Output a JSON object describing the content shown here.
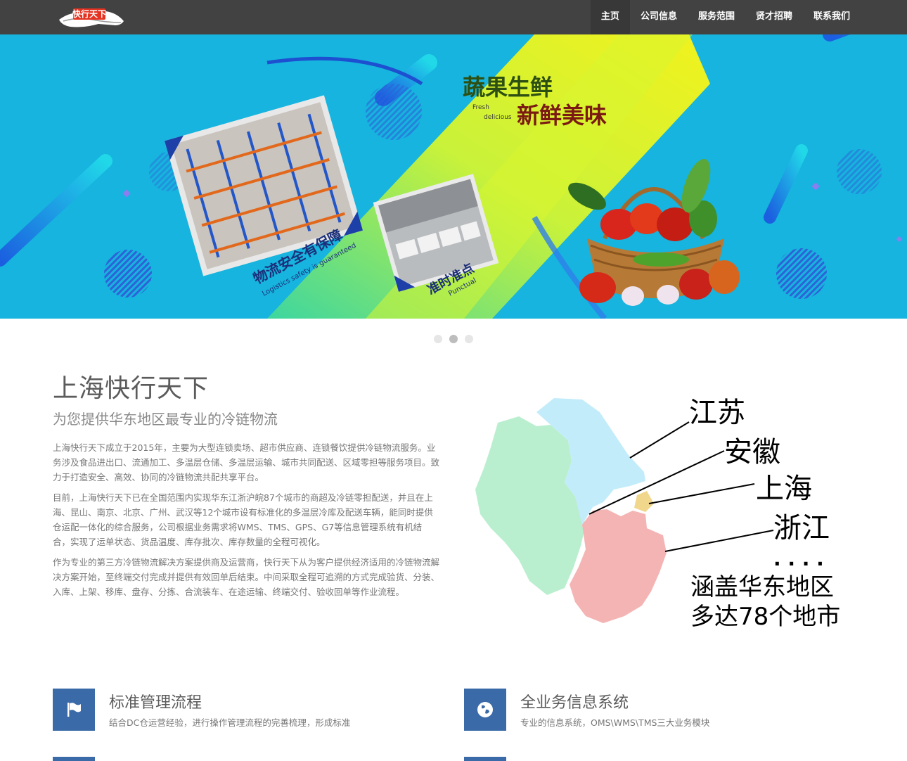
{
  "brand": {
    "logo_text": "快行天下"
  },
  "nav": {
    "items": [
      {
        "label": "主页"
      },
      {
        "label": "公司信息"
      },
      {
        "label": "服务范围"
      },
      {
        "label": "贤才招聘"
      },
      {
        "label": "联系我们"
      }
    ]
  },
  "banner": {
    "headline_1": "蔬果生鲜",
    "headline_2": "新鲜美味",
    "headline_en_1": "Fresh",
    "headline_en_2": "delicious",
    "tag_1": "物流安全有保障",
    "tag_1_en": "Logistics safety is guaranteed",
    "tag_2": "准时准点",
    "tag_2_en": "Punctual"
  },
  "carousel": {
    "slide_count": 3,
    "active_index": 1
  },
  "intro": {
    "title": "上海快行天下",
    "subtitle": "为您提供华东地区最专业的冷链物流",
    "paragraphs": [
      "上海快行天下成立于2015年，主要为大型连锁卖场、超市供应商、连锁餐饮提供冷链物流服务。业务涉及食品进出口、流通加工、多温层仓储、多温层运输、城市共同配送、区域零担等服务项目。致力于打造安全、高效、协同的冷链物流共配共享平台。",
      "目前，上海快行天下已在全国范围内实现华东江浙沪皖87个城市的商超及冷链零担配送，并且在上海、昆山、南京、北京、广州、武汉等12个城市设有标准化的多温层冷库及配送车辆，能同时提供仓运配一体化的综合服务，公司根据业务需求将WMS、TMS、GPS、G7等信息管理系统有机结合，实现了运单状态、货品温度、库存批次、库存数量的全程可视化。",
      "作为专业的第三方冷链物流解决方案提供商及运营商，快行天下从为客户提供经济适用的冷链物流解决方案开始，至终端交付完成并提供有效回单后结束。中间采取全程可追溯的方式完成验货、分装、入库、上架、移库、盘存、分拣、合流装车、在途运输、终端交付、验收回单等作业流程。"
    ]
  },
  "map": {
    "labels": [
      "江苏",
      "安徽",
      "上海",
      "浙江"
    ],
    "ellipsis": ". . . .",
    "coverage_line_1": "涵盖华东地区",
    "coverage_line_2": "多达78个地市",
    "colors": {
      "jiangsu": "#c3ecfb",
      "anhui": "#b9efcf",
      "shanghai": "#f0d78c",
      "zhejiang": "#f5b4b4"
    }
  },
  "features": [
    {
      "title": "标准管理流程",
      "desc": "结合DC仓运营经验，进行操作管理流程的完善梳理，形成标准",
      "icon": "flag-icon"
    },
    {
      "title": "全业务信息系统",
      "desc": "专业的信息系统，OMS\\WMS\\TMS三大业务模块",
      "icon": "globe-icon"
    }
  ]
}
